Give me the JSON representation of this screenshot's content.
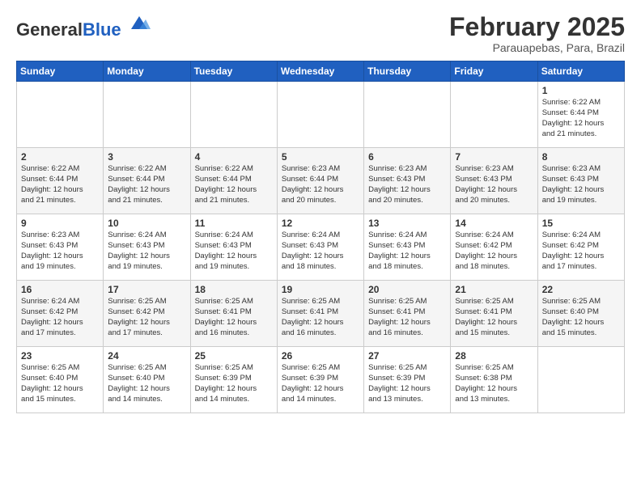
{
  "header": {
    "logo_general": "General",
    "logo_blue": "Blue",
    "title": "February 2025",
    "subtitle": "Parauapebas, Para, Brazil"
  },
  "weekdays": [
    "Sunday",
    "Monday",
    "Tuesday",
    "Wednesday",
    "Thursday",
    "Friday",
    "Saturday"
  ],
  "weeks": [
    [
      {
        "day": "",
        "info": ""
      },
      {
        "day": "",
        "info": ""
      },
      {
        "day": "",
        "info": ""
      },
      {
        "day": "",
        "info": ""
      },
      {
        "day": "",
        "info": ""
      },
      {
        "day": "",
        "info": ""
      },
      {
        "day": "1",
        "info": "Sunrise: 6:22 AM\nSunset: 6:44 PM\nDaylight: 12 hours\nand 21 minutes."
      }
    ],
    [
      {
        "day": "2",
        "info": "Sunrise: 6:22 AM\nSunset: 6:44 PM\nDaylight: 12 hours\nand 21 minutes."
      },
      {
        "day": "3",
        "info": "Sunrise: 6:22 AM\nSunset: 6:44 PM\nDaylight: 12 hours\nand 21 minutes."
      },
      {
        "day": "4",
        "info": "Sunrise: 6:22 AM\nSunset: 6:44 PM\nDaylight: 12 hours\nand 21 minutes."
      },
      {
        "day": "5",
        "info": "Sunrise: 6:23 AM\nSunset: 6:44 PM\nDaylight: 12 hours\nand 20 minutes."
      },
      {
        "day": "6",
        "info": "Sunrise: 6:23 AM\nSunset: 6:43 PM\nDaylight: 12 hours\nand 20 minutes."
      },
      {
        "day": "7",
        "info": "Sunrise: 6:23 AM\nSunset: 6:43 PM\nDaylight: 12 hours\nand 20 minutes."
      },
      {
        "day": "8",
        "info": "Sunrise: 6:23 AM\nSunset: 6:43 PM\nDaylight: 12 hours\nand 19 minutes."
      }
    ],
    [
      {
        "day": "9",
        "info": "Sunrise: 6:23 AM\nSunset: 6:43 PM\nDaylight: 12 hours\nand 19 minutes."
      },
      {
        "day": "10",
        "info": "Sunrise: 6:24 AM\nSunset: 6:43 PM\nDaylight: 12 hours\nand 19 minutes."
      },
      {
        "day": "11",
        "info": "Sunrise: 6:24 AM\nSunset: 6:43 PM\nDaylight: 12 hours\nand 19 minutes."
      },
      {
        "day": "12",
        "info": "Sunrise: 6:24 AM\nSunset: 6:43 PM\nDaylight: 12 hours\nand 18 minutes."
      },
      {
        "day": "13",
        "info": "Sunrise: 6:24 AM\nSunset: 6:43 PM\nDaylight: 12 hours\nand 18 minutes."
      },
      {
        "day": "14",
        "info": "Sunrise: 6:24 AM\nSunset: 6:42 PM\nDaylight: 12 hours\nand 18 minutes."
      },
      {
        "day": "15",
        "info": "Sunrise: 6:24 AM\nSunset: 6:42 PM\nDaylight: 12 hours\nand 17 minutes."
      }
    ],
    [
      {
        "day": "16",
        "info": "Sunrise: 6:24 AM\nSunset: 6:42 PM\nDaylight: 12 hours\nand 17 minutes."
      },
      {
        "day": "17",
        "info": "Sunrise: 6:25 AM\nSunset: 6:42 PM\nDaylight: 12 hours\nand 17 minutes."
      },
      {
        "day": "18",
        "info": "Sunrise: 6:25 AM\nSunset: 6:41 PM\nDaylight: 12 hours\nand 16 minutes."
      },
      {
        "day": "19",
        "info": "Sunrise: 6:25 AM\nSunset: 6:41 PM\nDaylight: 12 hours\nand 16 minutes."
      },
      {
        "day": "20",
        "info": "Sunrise: 6:25 AM\nSunset: 6:41 PM\nDaylight: 12 hours\nand 16 minutes."
      },
      {
        "day": "21",
        "info": "Sunrise: 6:25 AM\nSunset: 6:41 PM\nDaylight: 12 hours\nand 15 minutes."
      },
      {
        "day": "22",
        "info": "Sunrise: 6:25 AM\nSunset: 6:40 PM\nDaylight: 12 hours\nand 15 minutes."
      }
    ],
    [
      {
        "day": "23",
        "info": "Sunrise: 6:25 AM\nSunset: 6:40 PM\nDaylight: 12 hours\nand 15 minutes."
      },
      {
        "day": "24",
        "info": "Sunrise: 6:25 AM\nSunset: 6:40 PM\nDaylight: 12 hours\nand 14 minutes."
      },
      {
        "day": "25",
        "info": "Sunrise: 6:25 AM\nSunset: 6:39 PM\nDaylight: 12 hours\nand 14 minutes."
      },
      {
        "day": "26",
        "info": "Sunrise: 6:25 AM\nSunset: 6:39 PM\nDaylight: 12 hours\nand 14 minutes."
      },
      {
        "day": "27",
        "info": "Sunrise: 6:25 AM\nSunset: 6:39 PM\nDaylight: 12 hours\nand 13 minutes."
      },
      {
        "day": "28",
        "info": "Sunrise: 6:25 AM\nSunset: 6:38 PM\nDaylight: 12 hours\nand 13 minutes."
      },
      {
        "day": "",
        "info": ""
      }
    ]
  ]
}
